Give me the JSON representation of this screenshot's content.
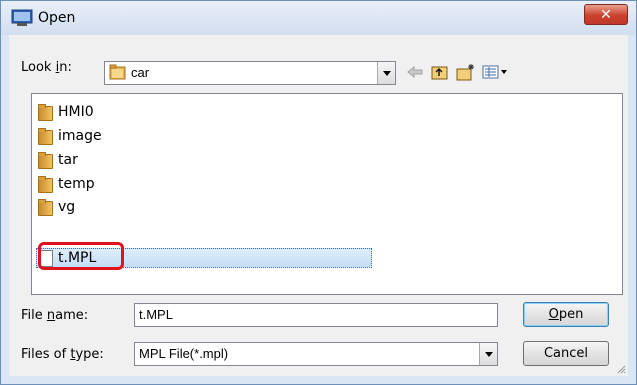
{
  "window": {
    "title": "Open",
    "close_label": "✕"
  },
  "lookin": {
    "label_pre": "Look ",
    "label_accel": "i",
    "label_post": "n:",
    "value": "car"
  },
  "toolbar": {
    "icons": [
      "back-icon",
      "up-folder-icon",
      "new-folder-icon",
      "view-menu-icon"
    ]
  },
  "files": [
    {
      "name": "HMI0",
      "type": "folder"
    },
    {
      "name": "image",
      "type": "folder"
    },
    {
      "name": "tar",
      "type": "folder"
    },
    {
      "name": "temp",
      "type": "folder"
    },
    {
      "name": "vg",
      "type": "folder"
    },
    {
      "name": "t.MPL",
      "type": "file",
      "selected": true
    }
  ],
  "filename": {
    "label_pre": "File ",
    "label_accel": "n",
    "label_post": "ame:",
    "value": "t.MPL"
  },
  "filetype": {
    "label_pre": "Files of ",
    "label_accel": "t",
    "label_post": "ype:",
    "value": "MPL File(*.mpl)"
  },
  "buttons": {
    "open_accel": "O",
    "open_rest": "pen",
    "cancel": "Cancel"
  },
  "colors": {
    "highlight": "#e0121d",
    "close": "#c8432d"
  }
}
